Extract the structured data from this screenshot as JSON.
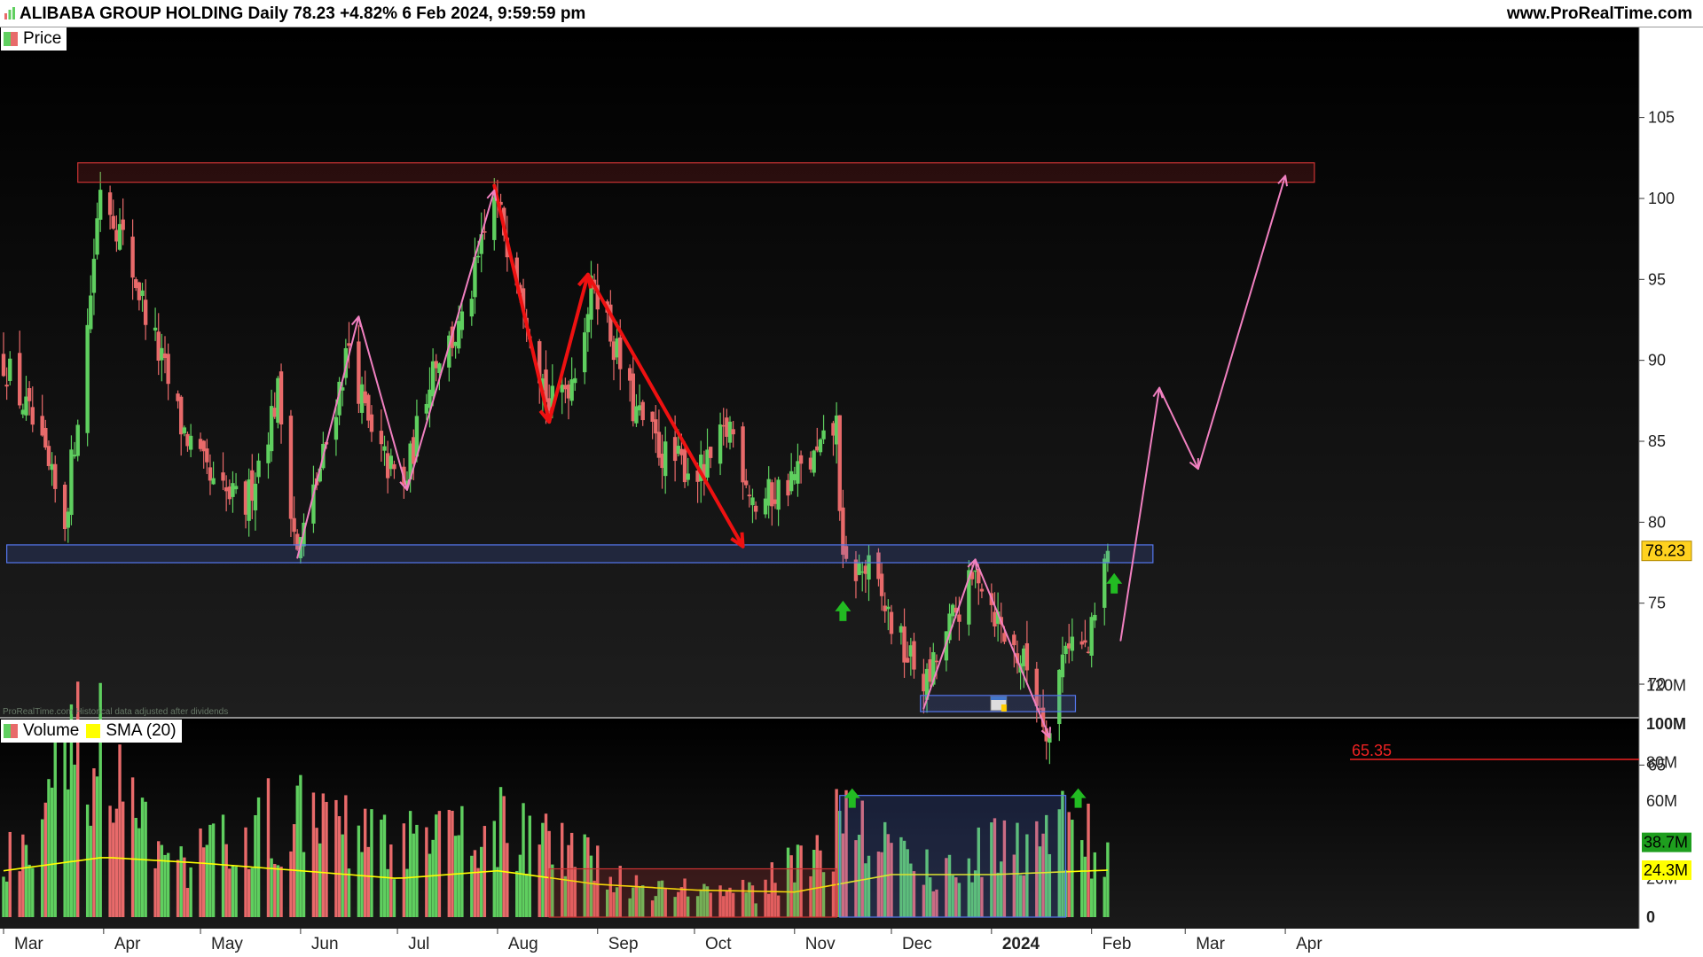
{
  "header": {
    "title": "ALIBABA GROUP HOLDING Daily 78.23 +4.82% 6 Feb 2024, 9:59:59 pm",
    "site": "www.ProRealTime.com"
  },
  "legend": {
    "price_label": "Price",
    "volume_label": "Volume",
    "sma_label": "SMA (20)"
  },
  "watermark": "ProRealTime.com  Historical data adjusted after dividends",
  "colors": {
    "up": "#5fcf5f",
    "down": "#e86a6a",
    "sma": "#ffff00",
    "red_arrow": "#ee1111",
    "pink_arrow": "#f080c0",
    "green_arrow": "#22bb22",
    "support_zone": "#5577ee",
    "resistance_zone": "#cc3333"
  },
  "chart_data": [
    {
      "type": "candlestick",
      "title": "ALIBABA GROUP HOLDING Daily",
      "last_price": 78.23,
      "last_price_label": "78.23",
      "level_line_label": "65.35",
      "level_line_value": 65.35,
      "ylim": [
        65,
        106
      ],
      "y_ticks": [
        "105",
        "100",
        "95",
        "90",
        "85",
        "80",
        "75",
        "70",
        "65"
      ],
      "x_ticks": [
        "Mar",
        "Apr",
        "May",
        "Jun",
        "Jul",
        "Aug",
        "Sep",
        "Oct",
        "Nov",
        "Dec",
        "2024",
        "Feb",
        "Mar",
        "Apr"
      ],
      "approx_closes": [
        {
          "date": "2023-03-01",
          "value": 90
        },
        {
          "date": "2023-03-10",
          "value": 86
        },
        {
          "date": "2023-03-20",
          "value": 80
        },
        {
          "date": "2023-03-27",
          "value": 92
        },
        {
          "date": "2023-03-31",
          "value": 101
        },
        {
          "date": "2023-04-06",
          "value": 98
        },
        {
          "date": "2023-04-14",
          "value": 93
        },
        {
          "date": "2023-04-25",
          "value": 86
        },
        {
          "date": "2023-05-05",
          "value": 82
        },
        {
          "date": "2023-05-15",
          "value": 81
        },
        {
          "date": "2023-05-25",
          "value": 88
        },
        {
          "date": "2023-05-31",
          "value": 78
        },
        {
          "date": "2023-06-08",
          "value": 84
        },
        {
          "date": "2023-06-16",
          "value": 91
        },
        {
          "date": "2023-06-23",
          "value": 85
        },
        {
          "date": "2023-07-03",
          "value": 82
        },
        {
          "date": "2023-07-12",
          "value": 90
        },
        {
          "date": "2023-07-21",
          "value": 92
        },
        {
          "date": "2023-07-31",
          "value": 100
        },
        {
          "date": "2023-08-08",
          "value": 95
        },
        {
          "date": "2023-08-17",
          "value": 87
        },
        {
          "date": "2023-08-24",
          "value": 89
        },
        {
          "date": "2023-08-31",
          "value": 95
        },
        {
          "date": "2023-09-12",
          "value": 87
        },
        {
          "date": "2023-09-22",
          "value": 84
        },
        {
          "date": "2023-10-04",
          "value": 83
        },
        {
          "date": "2023-10-12",
          "value": 86
        },
        {
          "date": "2023-10-20",
          "value": 81
        },
        {
          "date": "2023-10-27",
          "value": 82
        },
        {
          "date": "2023-11-08",
          "value": 84
        },
        {
          "date": "2023-11-14",
          "value": 86
        },
        {
          "date": "2023-11-16",
          "value": 77
        },
        {
          "date": "2023-11-24",
          "value": 77
        },
        {
          "date": "2023-12-05",
          "value": 72
        },
        {
          "date": "2023-12-12",
          "value": 70
        },
        {
          "date": "2023-12-20",
          "value": 74
        },
        {
          "date": "2023-12-28",
          "value": 77
        },
        {
          "date": "2024-01-05",
          "value": 73
        },
        {
          "date": "2024-01-12",
          "value": 71
        },
        {
          "date": "2024-01-19",
          "value": 67
        },
        {
          "date": "2024-01-24",
          "value": 73
        },
        {
          "date": "2024-01-31",
          "value": 72
        },
        {
          "date": "2024-02-06",
          "value": 78.23
        }
      ],
      "zones": [
        {
          "kind": "resistance",
          "from": "2023-03-24",
          "to": "2024-04-10",
          "low": 101,
          "high": 102.2
        },
        {
          "kind": "support",
          "from": "2023-03-02",
          "to": "2024-02-20",
          "low": 77.5,
          "high": 78.6
        },
        {
          "kind": "support",
          "from": "2023-12-10",
          "to": "2024-01-27",
          "low": 68.3,
          "high": 69.3
        }
      ],
      "annotations": [
        {
          "kind": "red_arrow_path",
          "points": [
            [
              "2023-07-31",
              100.8
            ],
            [
              "2023-08-17",
              86.2
            ],
            [
              "2023-08-29",
              95.3
            ],
            [
              "2023-10-16",
              78.5
            ]
          ]
        },
        {
          "kind": "pink_arrow_path",
          "points": [
            [
              "2023-05-31",
              77.8
            ],
            [
              "2023-06-19",
              92.7
            ],
            [
              "2023-07-04",
              82.0
            ],
            [
              "2023-07-31",
              100.5
            ]
          ]
        },
        {
          "kind": "pink_arrow_path",
          "points": [
            [
              "2023-12-11",
              68.5
            ],
            [
              "2023-12-27",
              77.7
            ],
            [
              "2024-01-19",
              66.7
            ]
          ]
        },
        {
          "kind": "pink_arrow_path",
          "points": [
            [
              "2024-02-10",
              72.7
            ],
            [
              "2024-02-22",
              88.3
            ],
            [
              "2024-03-05",
              83.3
            ],
            [
              "2024-04-01",
              101.4
            ]
          ]
        },
        {
          "kind": "green_up_arrow",
          "date": "2023-11-16",
          "value": 74.5
        },
        {
          "kind": "green_up_arrow",
          "date": "2024-02-08",
          "value": 76.2
        }
      ]
    },
    {
      "type": "bar",
      "title": "Volume",
      "series": [
        {
          "name": "Volume"
        },
        {
          "name": "SMA (20)"
        }
      ],
      "ylim": [
        0,
        120
      ],
      "y_ticks": [
        "120M",
        "100M",
        "80M",
        "60M",
        "40M",
        "20M",
        "0"
      ],
      "last_volume_label": "38.7M",
      "sma_label_value": "24.3M",
      "approx_volume_m": [
        {
          "date": "2023-03-01",
          "value": 35
        },
        {
          "date": "2023-03-28",
          "value": 100
        },
        {
          "date": "2023-04-20",
          "value": 25
        },
        {
          "date": "2023-05-26",
          "value": 58
        },
        {
          "date": "2023-07-03",
          "value": 40
        },
        {
          "date": "2023-08-02",
          "value": 52
        },
        {
          "date": "2023-09-15",
          "value": 18
        },
        {
          "date": "2023-10-20",
          "value": 14
        },
        {
          "date": "2023-11-16",
          "value": 55
        },
        {
          "date": "2023-12-15",
          "value": 25
        },
        {
          "date": "2024-01-22",
          "value": 55
        },
        {
          "date": "2024-02-06",
          "value": 38.7
        }
      ],
      "sma_approx_m": [
        {
          "date": "2023-03-01",
          "value": 24
        },
        {
          "date": "2023-04-01",
          "value": 31
        },
        {
          "date": "2023-05-01",
          "value": 28
        },
        {
          "date": "2023-06-01",
          "value": 24
        },
        {
          "date": "2023-07-01",
          "value": 20
        },
        {
          "date": "2023-08-01",
          "value": 24
        },
        {
          "date": "2023-09-01",
          "value": 17
        },
        {
          "date": "2023-10-01",
          "value": 14
        },
        {
          "date": "2023-11-01",
          "value": 13
        },
        {
          "date": "2023-12-01",
          "value": 22
        },
        {
          "date": "2024-01-01",
          "value": 22
        },
        {
          "date": "2024-02-06",
          "value": 24.3
        }
      ],
      "zones": [
        {
          "kind": "low_volume",
          "from": "2023-08-17",
          "to": "2023-11-14",
          "low": 0,
          "high": 25
        },
        {
          "kind": "high_volume",
          "from": "2023-11-15",
          "to": "2024-01-24",
          "low": 0,
          "high": 63
        }
      ]
    }
  ]
}
